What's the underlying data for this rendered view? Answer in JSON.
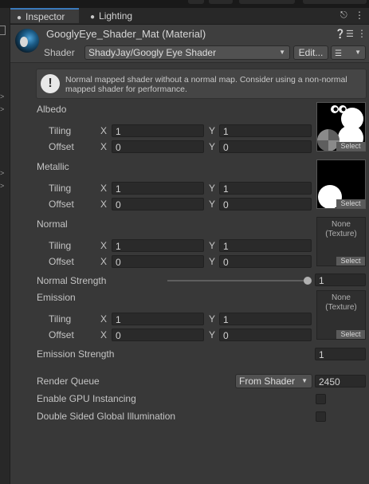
{
  "tabs": [
    {
      "label": "Inspector",
      "icon": "info-icon"
    },
    {
      "label": "Lighting",
      "icon": "lightbulb-icon"
    }
  ],
  "header": {
    "title": "GooglyEye_Shader_Mat (Material)",
    "shader_label": "Shader",
    "shader_value": "ShadyJay/Googly Eye Shader",
    "edit_label": "Edit..."
  },
  "help": {
    "text": "Normal mapped shader without a normal map. Consider using a non-normal mapped shader for performance."
  },
  "texture_select_label": "Select",
  "texture_none_label": "None\n(Texture)",
  "axis": {
    "x": "X",
    "y": "Y"
  },
  "props": {
    "tiling_label": "Tiling",
    "offset_label": "Offset",
    "albedo": {
      "label": "Albedo",
      "tiling_x": "1",
      "tiling_y": "1",
      "offset_x": "0",
      "offset_y": "0"
    },
    "metallic": {
      "label": "Metallic",
      "tiling_x": "1",
      "tiling_y": "1",
      "offset_x": "0",
      "offset_y": "0"
    },
    "normal": {
      "label": "Normal",
      "tiling_x": "1",
      "tiling_y": "1",
      "offset_x": "0",
      "offset_y": "0"
    },
    "normal_strength": {
      "label": "Normal Strength",
      "value": "1",
      "slider_fraction": 1.0
    },
    "emission": {
      "label": "Emission",
      "tiling_x": "1",
      "tiling_y": "1",
      "offset_x": "0",
      "offset_y": "0"
    },
    "emission_strength": {
      "label": "Emission Strength",
      "value": "1"
    },
    "render_queue": {
      "label": "Render Queue",
      "mode": "From Shader",
      "value": "2450"
    },
    "gpu_instancing": {
      "label": "Enable GPU Instancing",
      "checked": false
    },
    "double_sided_gi": {
      "label": "Double Sided Global Illumination",
      "checked": false
    }
  },
  "colors": {
    "accent": "#3a79bb",
    "panel": "#383838",
    "field": "#2a2a2a"
  }
}
